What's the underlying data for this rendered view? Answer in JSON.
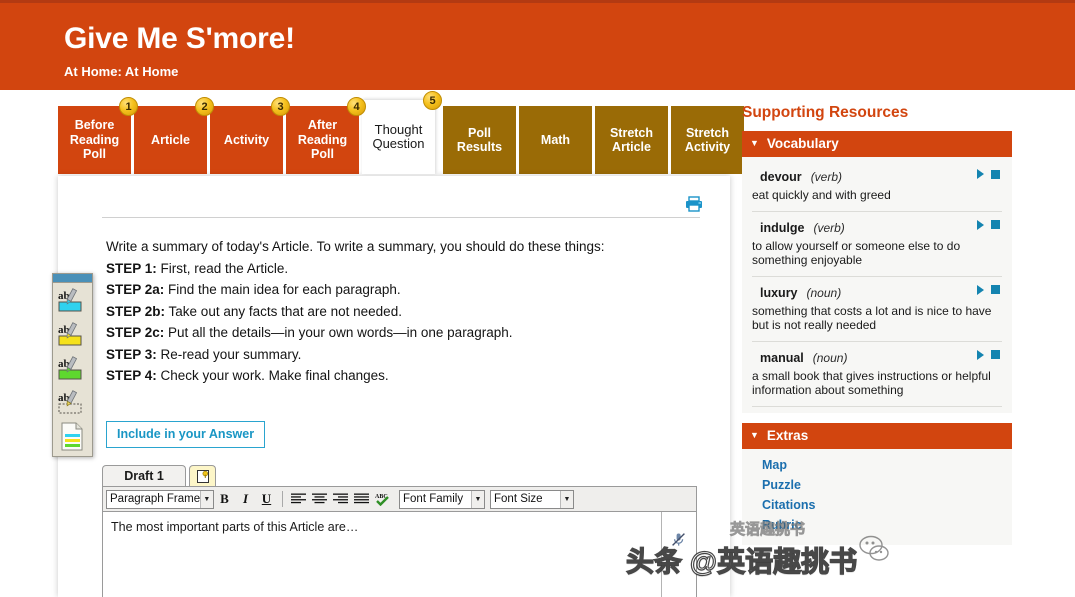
{
  "header": {
    "title": "Give Me S'more!",
    "subtitle": "At Home: At Home",
    "bg_color": "#d2450f"
  },
  "tabs": [
    {
      "label": "Before Reading Poll",
      "badge": "1",
      "state": "orange"
    },
    {
      "label": "Article",
      "badge": "2",
      "state": "orange"
    },
    {
      "label": "Activity",
      "badge": "3",
      "state": "orange"
    },
    {
      "label": "After Reading Poll",
      "badge": "4",
      "state": "orange"
    },
    {
      "label": "Thought Question",
      "badge": "5",
      "state": "active"
    },
    {
      "label": "Poll Results",
      "badge": "",
      "state": "gold"
    },
    {
      "label": "Math",
      "badge": "",
      "state": "gold"
    },
    {
      "label": "Stretch Article",
      "badge": "",
      "state": "gold"
    },
    {
      "label": "Stretch Activity",
      "badge": "",
      "state": "gold"
    }
  ],
  "content": {
    "print_icon": "printer-icon",
    "intro": "Write a summary of today's Article. To write a summary, you should do these things:",
    "steps": [
      {
        "label": "STEP 1:",
        "text": "First, read the Article."
      },
      {
        "label": "STEP 2a:",
        "text": "Find the main idea for each paragraph."
      },
      {
        "label": "STEP 2b:",
        "text": "Take out any facts that are not needed."
      },
      {
        "label": "STEP 2c:",
        "text": "Put all the details—in your own words—in one paragraph."
      },
      {
        "label": "STEP 3:",
        "text": "Re-read your summary."
      },
      {
        "label": "STEP 4:",
        "text": "Check your work. Make final changes."
      }
    ],
    "include_button": "Include in your Answer"
  },
  "editor": {
    "draft_tab": "Draft 1",
    "note_tab_icon": "sticky-note-icon",
    "toolbar": {
      "paragraph_frames": "Paragraph Frames",
      "bold": "B",
      "italic": "I",
      "underline": "U",
      "align_left": "align-left-icon",
      "align_center": "align-center-icon",
      "align_right": "align-right-icon",
      "align_justify": "align-justify-icon",
      "spellcheck": "ABC",
      "font_family": "Font Family",
      "font_size": "Font Size"
    },
    "body_text": "The most important parts of this Article are…",
    "mic_icon": "microphone-muted-icon"
  },
  "highlighter_toolbar": {
    "tools": [
      {
        "name": "highlight-cyan",
        "color": "#2fd2ef"
      },
      {
        "name": "highlight-yellow",
        "color": "#f5e11a"
      },
      {
        "name": "highlight-green",
        "color": "#5ed82e"
      },
      {
        "name": "highlight-erase",
        "color": "#ffffff"
      },
      {
        "name": "notes-summary",
        "color": "#ffffff"
      }
    ]
  },
  "sidebar": {
    "title": "Supporting Resources",
    "vocabulary": {
      "heading": "Vocabulary",
      "caret": "▼",
      "items": [
        {
          "word": "devour",
          "pos": "(verb)",
          "definition": "eat quickly and with greed"
        },
        {
          "word": "indulge",
          "pos": "(verb)",
          "definition": "to allow yourself or someone else to do something enjoyable"
        },
        {
          "word": "luxury",
          "pos": "(noun)",
          "definition": "something that costs a lot and is nice to have but is not really needed"
        },
        {
          "word": "manual",
          "pos": "(noun)",
          "definition": "a small book that gives instructions or helpful information about something"
        }
      ]
    },
    "extras": {
      "heading": "Extras",
      "caret": "▼",
      "links": [
        "Map",
        "Puzzle",
        "Citations",
        "Rubric"
      ]
    }
  },
  "watermark": {
    "text": "头条 @英语趣挑书",
    "secondary": "英语趣挑书"
  }
}
